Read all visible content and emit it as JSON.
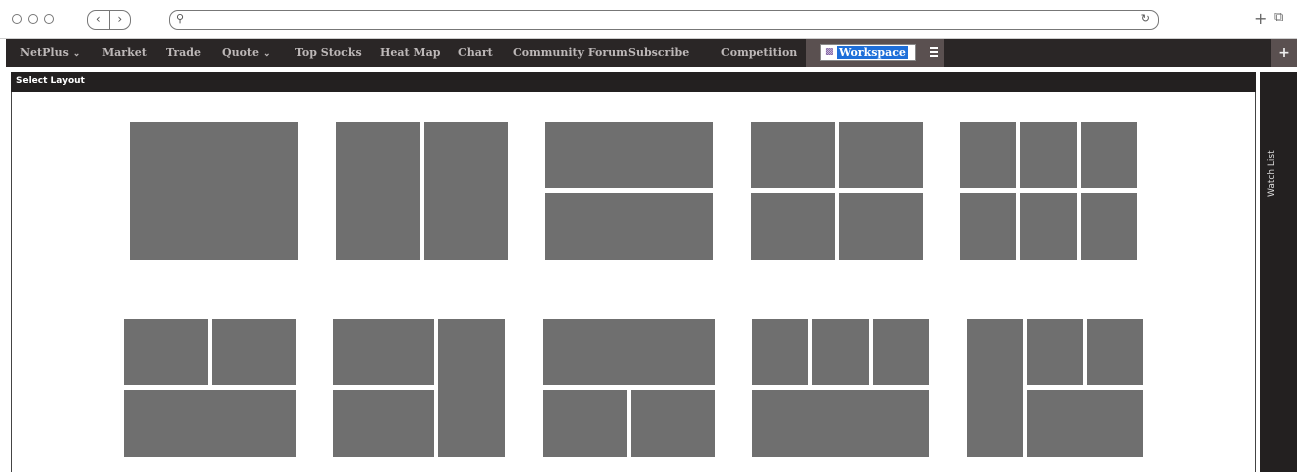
{
  "browser": {
    "back_icon": "chevron-left-icon",
    "forward_icon": "chevron-right-icon",
    "url": "",
    "new_tab_icon": "plus-icon",
    "tabs_icon": "tabs-icon"
  },
  "nav": {
    "items": [
      {
        "label": "NetPlus",
        "caret": "⌄"
      },
      {
        "label": "Market"
      },
      {
        "label": "Trade"
      },
      {
        "label": "Quote",
        "caret": "⌄"
      },
      {
        "label": "Top Stocks"
      },
      {
        "label": "Heat Map"
      },
      {
        "label": "Chart"
      },
      {
        "label": "Community Forum"
      },
      {
        "label": "Subscribe"
      },
      {
        "label": "Competition"
      }
    ],
    "workspace_value": "Workspace",
    "menu_icon": "hamburger-icon",
    "add_icon": "plus-icon"
  },
  "panel": {
    "title": "Select Layout"
  },
  "watchlist": {
    "label": "Watch List"
  },
  "layouts": [
    "single",
    "two-columns",
    "two-rows",
    "grid-2x2",
    "grid-3x2",
    "two-top-one-bottom",
    "two-left-stack-one-right",
    "one-top-two-bottom",
    "three-top-one-bottom",
    "one-left-three-right"
  ]
}
